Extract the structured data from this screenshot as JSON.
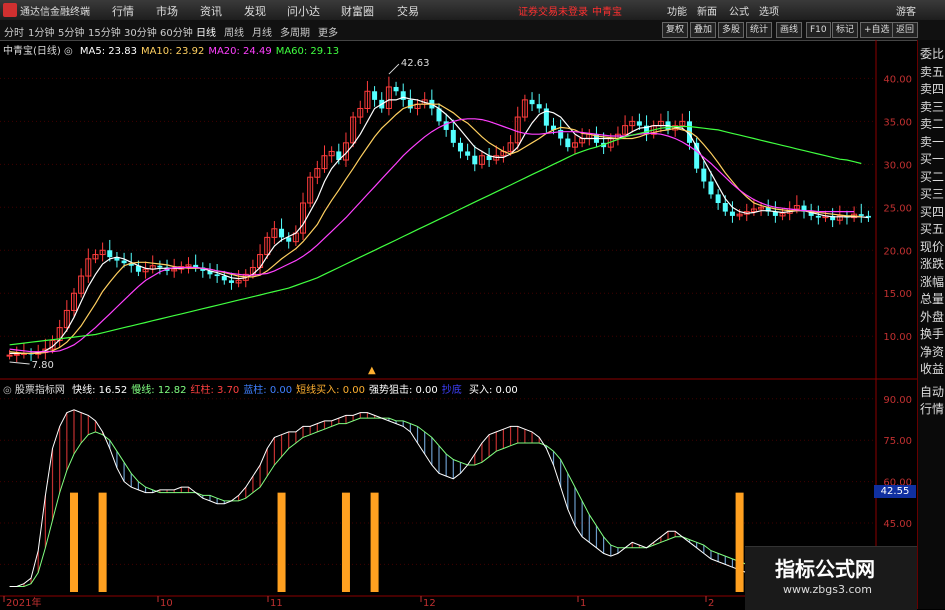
{
  "menubar": {
    "app_title": "通达信金融终端",
    "items": [
      "行情",
      "市场",
      "资讯",
      "发现",
      "问小达",
      "财富圈",
      "交易"
    ],
    "warning": "证券交易未登录",
    "stock_name": "中青宝",
    "right_items": [
      "功能",
      "新面",
      "公式",
      "选项"
    ],
    "guest": "游客"
  },
  "toolbar": {
    "periods": [
      "分时",
      "1分钟",
      "5分钟",
      "15分钟",
      "30分钟",
      "60分钟",
      "日线",
      "周线",
      "月线",
      "多周期",
      "更多"
    ],
    "active_period": "日线",
    "buttons": [
      "复权",
      "叠加",
      "多股",
      "统计",
      "画线",
      "F10",
      "标记",
      "+自选",
      "返回"
    ]
  },
  "main_chart": {
    "title": "中青宝(日线)",
    "ma": [
      {
        "label": "MA5:",
        "value": "23.83",
        "color": "#ffffff"
      },
      {
        "label": "MA10:",
        "value": "23.92",
        "color": "#ffd060"
      },
      {
        "label": "MA20:",
        "value": "24.49",
        "color": "#ff40ff"
      },
      {
        "label": "MA60:",
        "value": "29.13",
        "color": "#40ff40"
      }
    ],
    "high_label": "42.63",
    "low_label": "7.80",
    "y_ticks": [
      "40.00",
      "35.00",
      "30.00",
      "25.00",
      "20.00",
      "15.00",
      "10.00"
    ],
    "marker": "▲"
  },
  "indicator": {
    "name": "股票指标网",
    "fields": [
      {
        "label": "快线:",
        "value": "16.52",
        "color": "#ffffff"
      },
      {
        "label": "慢线:",
        "value": "12.82",
        "color": "#80ff80"
      },
      {
        "label": "红柱:",
        "value": "3.70",
        "color": "#ff4040"
      },
      {
        "label": "蓝柱:",
        "value": "0.00",
        "color": "#4080ff"
      },
      {
        "label": "短线买入:",
        "value": "0.00",
        "color": "#ffb030"
      },
      {
        "label": "强势狙击:",
        "value": "0.00",
        "color": "#ffffff"
      },
      {
        "label": "抄底",
        "value": "",
        "color": "#4040ff"
      },
      {
        "label": "买入:",
        "value": "0.00",
        "color": "#ffffff"
      }
    ],
    "y_ticks": [
      "90.00",
      "75.00",
      "60.00",
      "45.00",
      "30.00"
    ],
    "price_badge": "42.55"
  },
  "x_axis": {
    "labels": [
      "2021年",
      "10",
      "11",
      "12",
      "1",
      "2"
    ]
  },
  "right_panel": {
    "items": [
      "委比",
      "卖五",
      "卖四",
      "卖三",
      "卖二",
      "卖一",
      "买一",
      "买二",
      "买三",
      "买四",
      "买五",
      "现价",
      "涨跌",
      "涨幅",
      "总量",
      "外盘",
      "换手",
      "净资",
      "收益"
    ],
    "items2": [
      "自动",
      "行情"
    ]
  },
  "watermark": {
    "title": "指标公式网",
    "url": "www.zbgs3.com"
  },
  "chart_data": {
    "type": "line",
    "x_label": "",
    "price_range": [
      7,
      44
    ],
    "close_series": [
      7.8,
      7.9,
      8.0,
      7.9,
      8.1,
      8.5,
      9.5,
      11,
      13,
      15,
      17,
      19,
      19.5,
      20,
      19.2,
      18.8,
      18.5,
      18.2,
      17.5,
      17.8,
      18.2,
      18.0,
      17.6,
      17.8,
      18.1,
      18.3,
      18.0,
      17.6,
      17.2,
      17.0,
      16.5,
      16.2,
      16.5,
      17.2,
      18.0,
      19.5,
      21.5,
      22.5,
      21.5,
      21.0,
      22.0,
      25.5,
      28.5,
      29.5,
      31.0,
      31.5,
      30.5,
      32.5,
      35.5,
      36.5,
      38.5,
      37.5,
      36.5,
      39.0,
      38.5,
      37.5,
      36.5,
      37.0,
      37.5,
      36.5,
      35.0,
      34.0,
      32.5,
      31.5,
      31.0,
      30.0,
      31.0,
      30.5,
      31.0,
      31.5,
      32.5,
      35.5,
      37.5,
      37.0,
      36.5,
      34.5,
      34.0,
      33.0,
      32.0,
      32.5,
      33.0,
      33.5,
      32.5,
      32.0,
      33.0,
      33.5,
      34.5,
      35.0,
      34.5,
      33.5,
      34.5,
      35.0,
      34.0,
      34.5,
      35.0,
      32.5,
      29.5,
      28.0,
      26.5,
      25.5,
      24.5,
      24.0,
      24.2,
      24.5,
      24.8,
      25.0,
      24.5,
      24.0,
      24.3,
      24.8,
      25.2,
      24.5,
      24.0,
      23.8,
      24.0,
      23.5,
      24.0,
      23.8,
      24.2,
      24.0,
      23.8
    ],
    "ma_series": [
      {
        "name": "MA5",
        "values": [
          8.0,
          8.0,
          8.0,
          8.0,
          8.1,
          8.3,
          8.8,
          9.6,
          10.7,
          12.2,
          14,
          15.8,
          17.2,
          18.4,
          19,
          19.2,
          19,
          18.6,
          18.2,
          17.9,
          17.8,
          17.9,
          17.9,
          17.9,
          17.9,
          18,
          18,
          17.9,
          17.6,
          17.4,
          17.1,
          16.8,
          16.7,
          16.8,
          17.2,
          18,
          19.3,
          20.5,
          21.2,
          21.6,
          22,
          23,
          24.5,
          26,
          28,
          29.5,
          30.5,
          31.3,
          32.3,
          33.5,
          35,
          36.5,
          37,
          37.5,
          37.5,
          37.8,
          37.6,
          37.5,
          37.2,
          37,
          36.5,
          35.8,
          35,
          34,
          33,
          32,
          31.5,
          31,
          30.8,
          30.8,
          31.2,
          32,
          33.5,
          34.8,
          35.8,
          36.2,
          36,
          35.5,
          34.5,
          33.5,
          33,
          33,
          33,
          33,
          33,
          33,
          33.3,
          33.8,
          34.2,
          34.3,
          34.5,
          34.5,
          34.5,
          34.3,
          34.2,
          33.5,
          32,
          30.5,
          29,
          27.5,
          26,
          25,
          24.5,
          24.3,
          24.4,
          24.6,
          24.6,
          24.5,
          24.4,
          24.5,
          24.6,
          24.6,
          24.4,
          24.2,
          24,
          23.9,
          23.9,
          23.9,
          23.9,
          23.9,
          23.8
        ]
      },
      {
        "name": "MA10",
        "values": [
          8.2,
          8.1,
          8.0,
          8.0,
          8.0,
          8.1,
          8.3,
          8.7,
          9.3,
          10.2,
          11.2,
          12.5,
          13.8,
          15.2,
          16.3,
          17.3,
          18.2,
          18.5,
          18.6,
          18.6,
          18.5,
          18.4,
          18.3,
          18.1,
          18,
          17.9,
          17.9,
          17.9,
          17.8,
          17.6,
          17.4,
          17.2,
          17,
          16.9,
          16.9,
          17.1,
          17.6,
          18.3,
          19,
          19.6,
          20.2,
          21,
          22,
          23,
          24.5,
          25.8,
          27,
          28.3,
          29.5,
          30.8,
          32,
          33.2,
          34.2,
          35,
          35.8,
          36.5,
          36.8,
          37,
          37,
          37,
          37,
          36.5,
          36,
          35.3,
          34.8,
          34,
          33.2,
          32.5,
          32,
          31.5,
          31.2,
          31.5,
          32,
          32.5,
          33,
          33.6,
          34,
          34.3,
          34.2,
          34,
          33.6,
          33.5,
          33.3,
          33.2,
          33.1,
          33,
          33,
          33,
          33.2,
          33.5,
          33.7,
          33.9,
          34,
          34.2,
          34,
          33.8,
          33.2,
          32.3,
          31.3,
          30.2,
          29,
          28,
          27,
          26.2,
          25.5,
          25.2,
          25,
          24.8,
          24.7,
          24.6,
          24.6,
          24.6,
          24.5,
          24.4,
          24.3,
          24.2,
          24.1,
          24,
          24,
          23.9
        ]
      },
      {
        "name": "MA20",
        "values": [
          8.5,
          8.4,
          8.3,
          8.2,
          8.2,
          8.2,
          8.2,
          8.3,
          8.6,
          9,
          9.6,
          10.3,
          11,
          11.8,
          12.6,
          13.4,
          14.2,
          15,
          15.8,
          16.5,
          17,
          17.5,
          17.8,
          18,
          18,
          18,
          18,
          17.9,
          17.8,
          17.6,
          17.5,
          17.3,
          17.2,
          17.1,
          17.1,
          17.2,
          17.3,
          17.6,
          18,
          18.4,
          18.8,
          19.3,
          19.9,
          20.6,
          21.4,
          22.2,
          23,
          23.8,
          24.7,
          25.6,
          26.5,
          27.4,
          28.3,
          29.2,
          30.1,
          31,
          31.8,
          32.5,
          33.2,
          33.8,
          34.3,
          34.7,
          35,
          35.2,
          35.3,
          35.3,
          35.2,
          35,
          34.7,
          34.4,
          34.1,
          33.8,
          33.6,
          33.5,
          33.5,
          33.6,
          33.7,
          33.8,
          33.8,
          33.8,
          33.7,
          33.6,
          33.5,
          33.4,
          33.3,
          33.3,
          33.3,
          33.4,
          33.5,
          33.6,
          33.6,
          33.5,
          33.3,
          33,
          32.6,
          32.1,
          31.5,
          30.8,
          30.1,
          29.3,
          28.5,
          27.7,
          27,
          26.4,
          25.9,
          25.5,
          25.2,
          25,
          24.9,
          24.8,
          24.7,
          24.6,
          24.6,
          24.5,
          24.5,
          24.5,
          24.5,
          24.5,
          24.5
        ]
      },
      {
        "name": "MA60",
        "values": [
          9,
          9.1,
          9.2,
          9.3,
          9.4,
          9.5,
          9.6,
          9.7,
          9.8,
          9.9,
          10,
          10.1,
          10.2,
          10.4,
          10.6,
          10.8,
          11,
          11.2,
          11.4,
          11.6,
          11.8,
          12,
          12.2,
          12.4,
          12.6,
          12.8,
          13,
          13.2,
          13.4,
          13.6,
          13.8,
          14,
          14.2,
          14.4,
          14.6,
          14.8,
          15,
          15.2,
          15.4,
          15.6,
          15.9,
          16.2,
          16.5,
          16.8,
          17.2,
          17.6,
          18,
          18.4,
          18.8,
          19.2,
          19.6,
          20,
          20.4,
          20.8,
          21.2,
          21.6,
          22,
          22.4,
          22.8,
          23.2,
          23.6,
          24,
          24.4,
          24.8,
          25.2,
          25.6,
          26,
          26.4,
          26.8,
          27.2,
          27.6,
          28,
          28.4,
          28.8,
          29.2,
          29.6,
          30,
          30.4,
          30.8,
          31.2,
          31.5,
          31.8,
          32,
          32.3,
          32.6,
          32.9,
          33.2,
          33.4,
          33.6,
          33.8,
          34,
          34.2,
          34.3,
          34.4,
          34.4,
          34.4,
          34.3,
          34.2,
          34.1,
          34,
          33.8,
          33.6,
          33.4,
          33.2,
          33,
          32.8,
          32.6,
          32.4,
          32.2,
          32,
          31.8,
          31.6,
          31.4,
          31.2,
          31,
          30.8,
          30.6,
          30.5,
          30.3,
          30.1
        ]
      }
    ],
    "indicator_range": [
      20,
      95
    ],
    "fast_line": [
      22,
      22,
      23,
      25,
      35,
      55,
      72,
      80,
      85,
      86,
      85,
      84,
      82,
      78,
      72,
      65,
      60,
      58,
      57,
      56,
      56,
      57,
      57,
      57,
      58,
      58,
      56,
      54,
      53,
      52,
      52,
      53,
      55,
      58,
      62,
      66,
      72,
      76,
      77,
      78,
      78,
      80,
      80,
      81,
      82,
      82,
      83,
      84,
      84,
      85,
      85,
      84,
      83,
      82,
      81,
      80,
      78,
      74,
      70,
      66,
      63,
      62,
      61,
      63,
      66,
      70,
      74,
      77,
      78,
      79,
      80,
      80,
      79,
      78,
      76,
      72,
      66,
      58,
      50,
      44,
      40,
      38,
      36,
      34,
      33,
      34,
      36,
      38,
      37,
      36,
      38,
      40,
      42,
      42,
      40,
      38,
      36,
      34,
      32,
      31,
      30,
      29,
      28,
      27,
      27,
      26,
      26,
      25,
      25,
      24,
      24,
      24,
      23,
      23,
      23,
      22,
      22,
      22,
      22,
      22,
      22,
      22
    ],
    "slow_line": [
      22,
      22,
      22,
      23,
      27,
      36,
      46,
      56,
      64,
      70,
      74,
      77,
      78,
      77,
      75,
      71,
      67,
      63,
      60,
      58,
      57,
      56,
      56,
      56,
      56,
      56,
      56,
      55,
      55,
      54,
      53,
      53,
      53,
      54,
      56,
      58,
      62,
      66,
      69,
      72,
      74,
      76,
      77,
      78,
      79,
      80,
      81,
      81,
      82,
      83,
      83,
      83,
      83,
      83,
      82,
      82,
      81,
      80,
      78,
      76,
      73,
      70,
      68,
      67,
      66,
      66,
      67,
      69,
      71,
      72,
      73,
      74,
      74,
      74,
      74,
      73,
      71,
      68,
      63,
      58,
      53,
      48,
      44,
      40,
      37,
      36,
      36,
      36,
      36,
      36,
      37,
      38,
      39,
      40,
      40,
      39,
      38,
      37,
      35,
      34,
      33,
      32,
      31,
      30,
      29,
      28,
      28,
      27,
      27,
      26,
      26,
      26,
      25,
      25,
      24,
      24,
      24,
      23,
      23,
      23,
      23,
      23
    ],
    "buy_signal_indices": [
      9,
      13,
      38,
      47,
      51,
      102
    ]
  }
}
